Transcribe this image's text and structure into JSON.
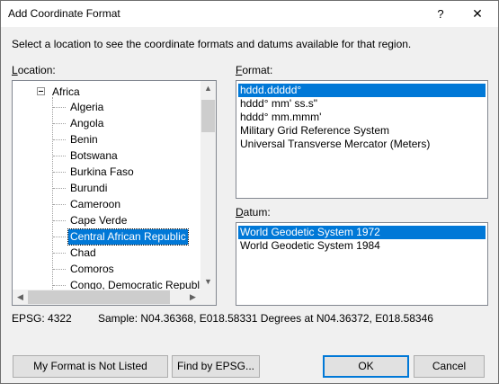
{
  "window": {
    "title": "Add Coordinate Format",
    "help_glyph": "?",
    "close_glyph": "✕"
  },
  "instructions": "Select a location to see the coordinate formats and datums available for that region.",
  "location": {
    "label_access": "L",
    "label_rest": "ocation:",
    "root": "Africa",
    "items": [
      "Algeria",
      "Angola",
      "Benin",
      "Botswana",
      "Burkina Faso",
      "Burundi",
      "Cameroon",
      "Cape Verde",
      "Central African Republic",
      "Chad",
      "Comoros",
      "Congo, Democratic Republi"
    ],
    "selected_item": "Central African Republic"
  },
  "format": {
    "label_access": "F",
    "label_rest": "ormat:",
    "items": [
      "hddd.ddddd°",
      "hddd° mm' ss.s\"",
      "hddd° mm.mmm'",
      "Military Grid Reference System",
      "Universal Transverse Mercator (Meters)"
    ],
    "selected_item": "hddd.ddddd°"
  },
  "datum": {
    "label_access": "D",
    "label_rest": "atum:",
    "items": [
      "World Geodetic System 1972",
      "World Geodetic System 1984"
    ],
    "selected_item": "World Geodetic System 1972"
  },
  "epsg_text": "EPSG: 4322",
  "sample_text": "Sample: N04.36368, E018.58331 Degrees at N04.36372, E018.58346",
  "buttons": {
    "not_listed": "My Format is Not Listed",
    "find_epsg": "Find by EPSG...",
    "ok": "OK",
    "cancel": "Cancel"
  },
  "colors": {
    "selection": "#0078d7",
    "default_border": "#0078d7"
  }
}
